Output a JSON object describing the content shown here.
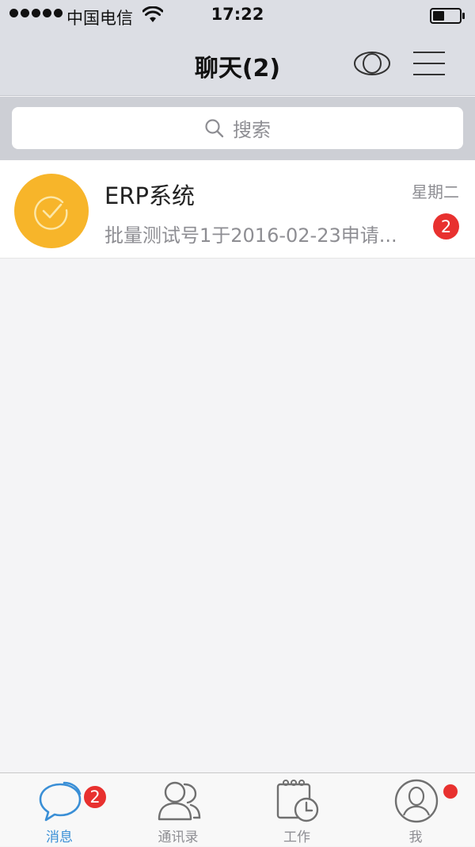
{
  "status_bar": {
    "carrier": "中国电信",
    "time": "17:22"
  },
  "nav": {
    "title": "聊天(2)"
  },
  "search": {
    "placeholder": "搜索"
  },
  "chats": [
    {
      "name": "ERP系统",
      "preview": "批量测试号1于2016-02-23申请...",
      "time": "星期二",
      "unread": "2"
    }
  ],
  "tabs": [
    {
      "label": "消息",
      "badge": "2",
      "active": true
    },
    {
      "label": "通讯录"
    },
    {
      "label": "工作"
    },
    {
      "label": "我",
      "has_dot": true
    }
  ],
  "colors": {
    "accent": "#3a8fd6",
    "badge": "#e8312f",
    "avatar_bg": "#f7b52a"
  }
}
